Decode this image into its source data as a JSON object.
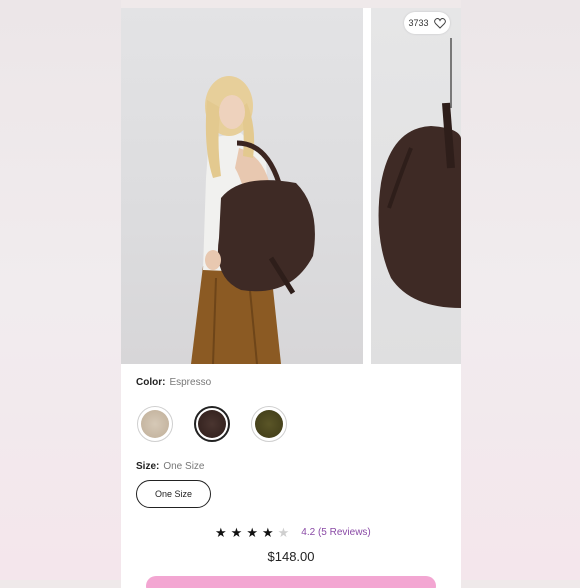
{
  "likes": {
    "count": "3733"
  },
  "color": {
    "label": "Color:",
    "selected": "Espresso",
    "swatches": [
      {
        "name": "Sand",
        "hex": "#cbbca9"
      },
      {
        "name": "Espresso",
        "hex": "#3e2a25"
      },
      {
        "name": "Olive",
        "hex": "#4b4720"
      }
    ]
  },
  "size": {
    "label": "Size:",
    "selected": "One Size",
    "option": "One Size"
  },
  "rating": {
    "stars": 4,
    "max": 5,
    "text": "4.2 (5 Reviews)"
  },
  "price": "$148.00",
  "colors": {
    "accent": "#8a4aa6",
    "cta": "#f3a6d2"
  }
}
